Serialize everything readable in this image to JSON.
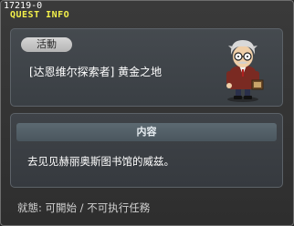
{
  "window": {
    "quest_id": "17219-0",
    "title": "QUEST INFO"
  },
  "quest": {
    "status_pill": "活動",
    "name": "[达恩维尔探索者] 黄金之地",
    "npc_icon": "scholar-npc-icon"
  },
  "content": {
    "header": "内容",
    "text": "去见见赫丽奥斯图书馆的威兹。"
  },
  "footer": {
    "status": "就態: 可開始 / 不可执行任務"
  },
  "colors": {
    "title": "#f3f04a",
    "panel": "#3f4348",
    "header_bar": "#52606a"
  }
}
